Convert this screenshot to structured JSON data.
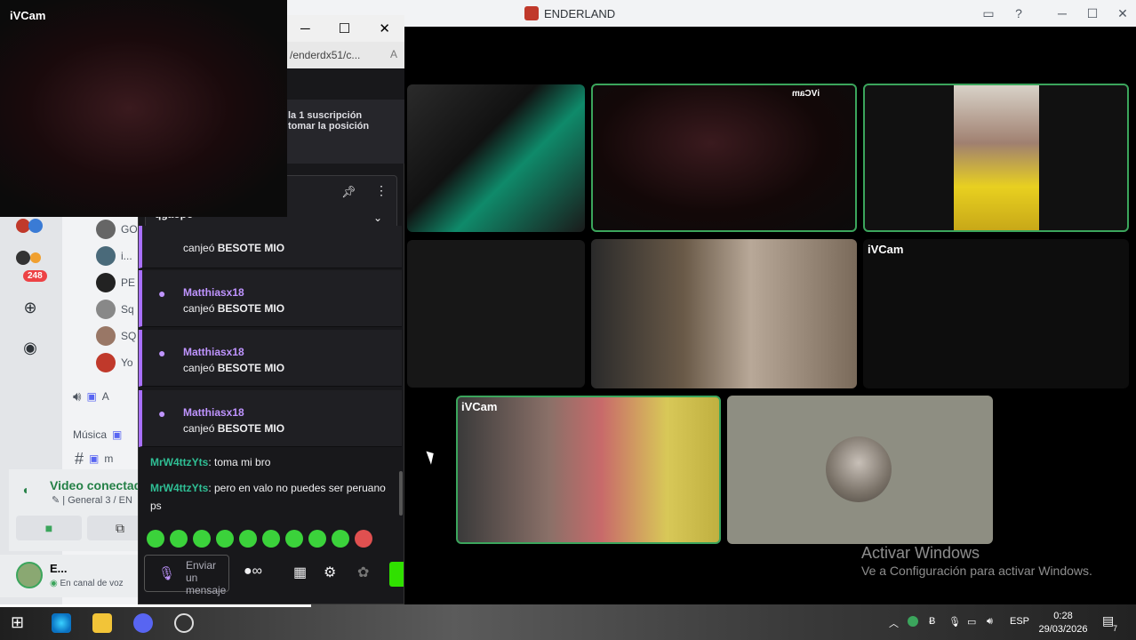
{
  "discord": {
    "window_title": "ENDERLAND",
    "colors": {
      "accent": "#3ba55c",
      "badge": "#ed4245"
    },
    "server_badge": "248",
    "members": [
      {
        "name": "GO",
        "icon": "avatar"
      },
      {
        "name": "i...",
        "icon": "avatar"
      },
      {
        "name": "PE",
        "icon": "avatar"
      },
      {
        "name": "Sq",
        "icon": "avatar"
      },
      {
        "name": "SQ",
        "icon": "avatar"
      },
      {
        "name": "Yo",
        "icon": "avatar"
      }
    ],
    "channels": [
      {
        "label": "A",
        "icon": "speaker-icon"
      },
      {
        "label": "Música",
        "icon": "folder-icon"
      },
      {
        "label": "m",
        "icon": "hash-icon"
      }
    ],
    "voice": {
      "status": "Video conectad",
      "channel": "| General 3 / EN"
    },
    "user": {
      "name": "E...",
      "status": "En canal de voz"
    },
    "tiles": [
      {
        "label": "iVCam",
        "mirrored": true
      },
      {
        "label": "iVCam"
      },
      {
        "label": "iVCam"
      }
    ],
    "activate_title": "Activar Windows",
    "activate_sub": "Ve a Configuración para activar Windows."
  },
  "browser": {
    "url": "/enderdx51/c...",
    "sub_notice": "la 1 suscripción\ntomar la posición",
    "pinned_partial": "qgaopo"
  },
  "chat": {
    "redeems": [
      {
        "user": "",
        "action": "canjeó",
        "reward": "BESOTE MIO"
      },
      {
        "user": "Matthiasx18",
        "action": "canjeó",
        "reward": "BESOTE MIO"
      },
      {
        "user": "Matthiasx18",
        "action": "canjeó",
        "reward": "BESOTE MIO"
      },
      {
        "user": "Matthiasx18",
        "action": "canjeó",
        "reward": "BESOTE MIO"
      }
    ],
    "messages": [
      {
        "author": "MrW4ttzYts",
        "text": ": toma mi bro"
      },
      {
        "author": "MrW4ttzYts",
        "text": ": pero en valo no puedes ser peruano ps"
      }
    ],
    "input_placeholder": "Enviar un mensaje",
    "emote_count": 10
  },
  "ivcam_preview": {
    "label": "iVCam"
  },
  "taskbar": {
    "language": "ESP",
    "time": "0:28",
    "date": "29/03/2026",
    "notifications": "7"
  }
}
